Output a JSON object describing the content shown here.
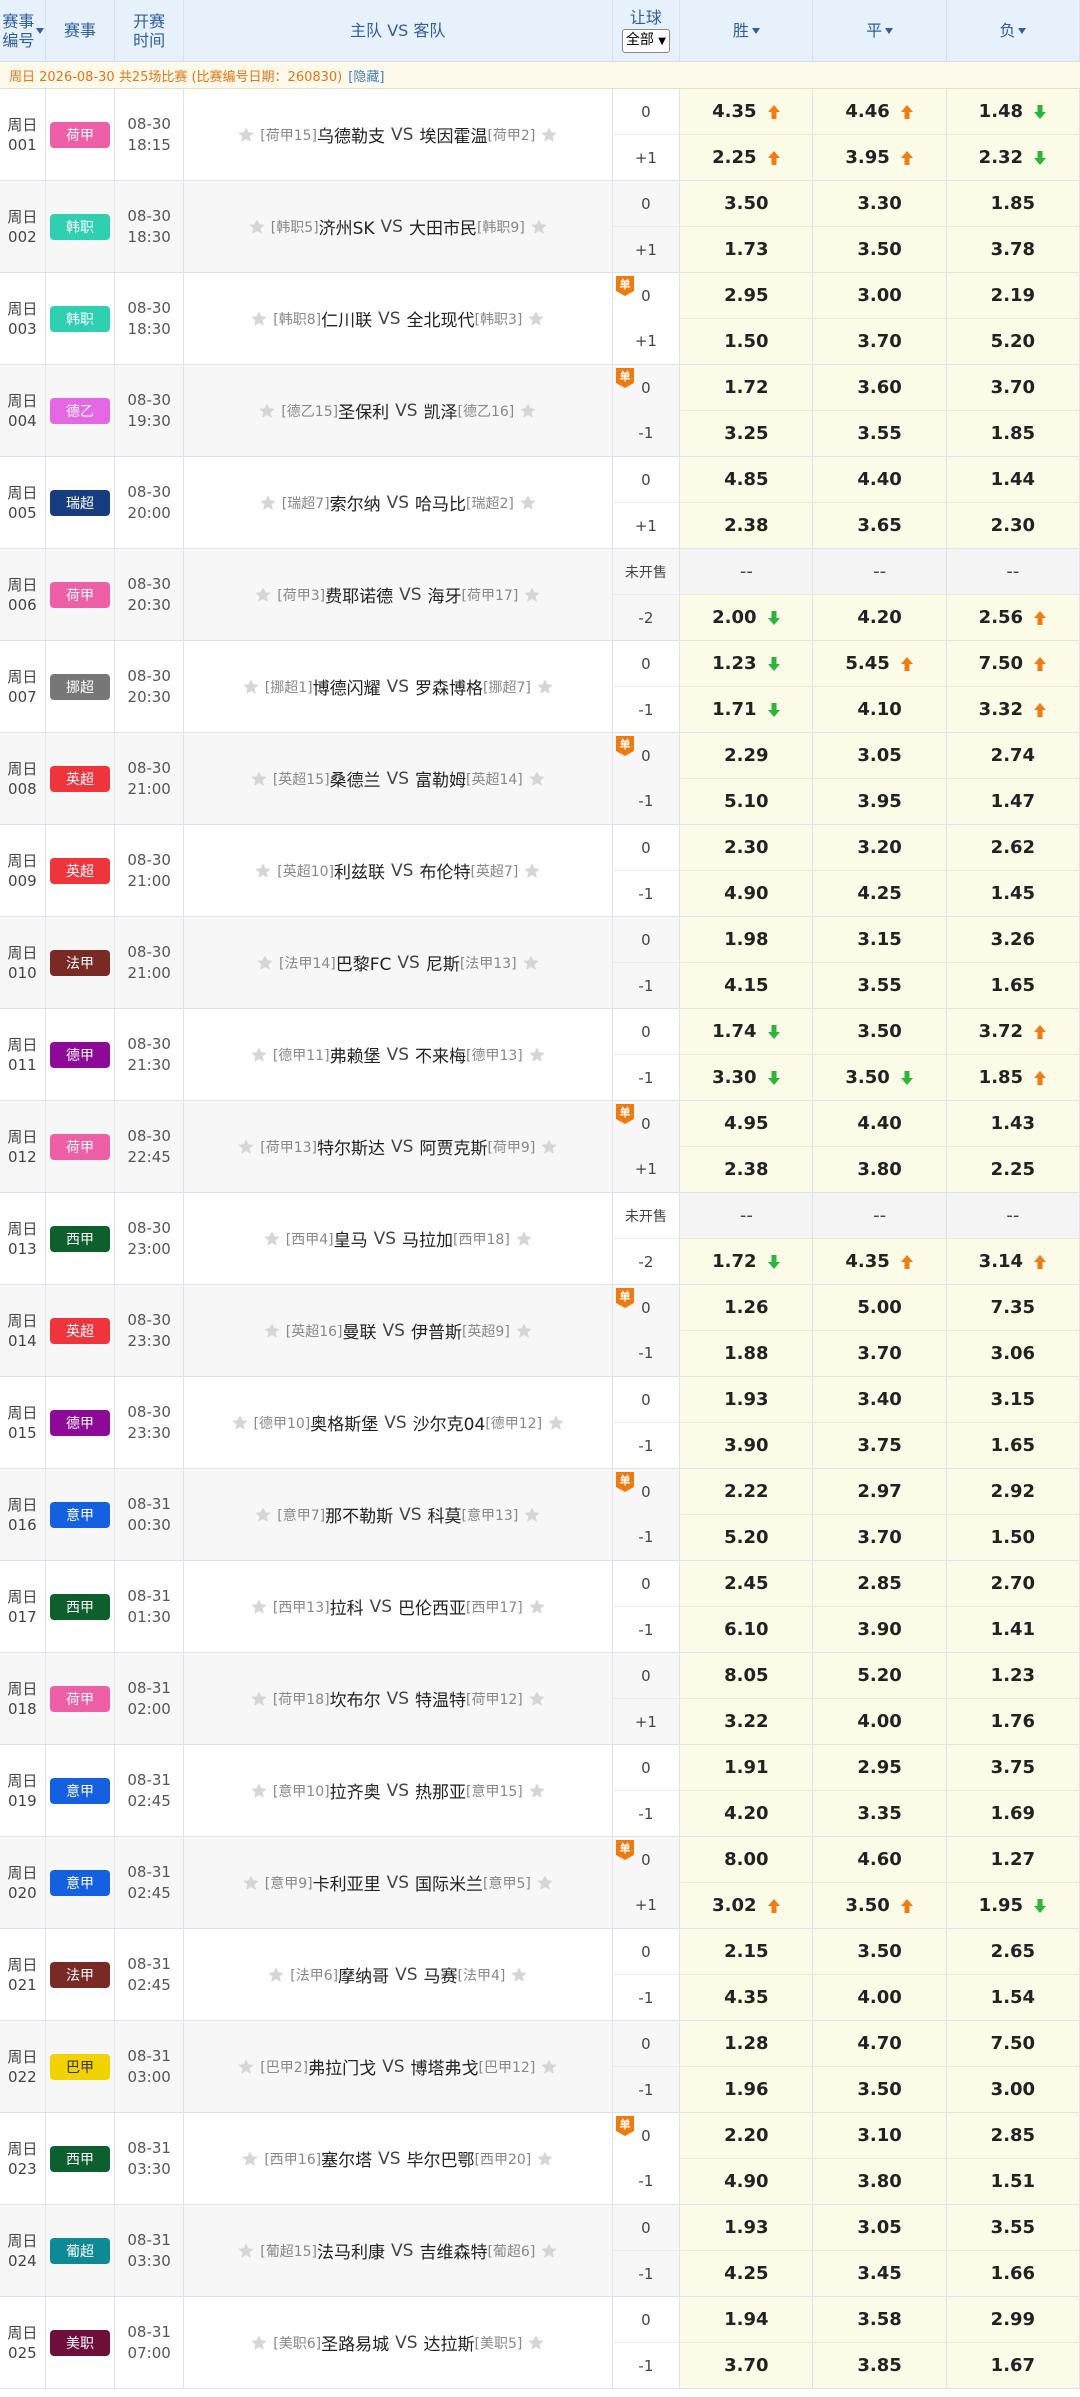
{
  "header": {
    "col1": "赛事编号",
    "col2": "赛事",
    "col3": "开赛时间",
    "col4": "主队 VS 客队",
    "col5": "让球",
    "select_value": "全部",
    "win": "胜",
    "draw": "平",
    "lose": "负"
  },
  "info": {
    "text": "周日 2026-08-30 共25场比赛 (比赛编号日期：260830)",
    "hide": "[隐藏]"
  },
  "not_sold": "未开售",
  "matches": [
    {
      "d": "周日",
      "n": "001",
      "lg": "荷甲",
      "lc": "#ee5fa7",
      "date": "08-30",
      "time": "18:15",
      "hr": "[荷甲15]",
      "h": "乌德勒支",
      "a": "埃因霍温",
      "ar": "[荷甲2]",
      "dan": false,
      "h1": "0",
      "h2": "+1",
      "o1": [
        "4.35",
        "4.46",
        "1.48"
      ],
      "a1": [
        "up",
        "up",
        "down"
      ],
      "o2": [
        "2.25",
        "3.95",
        "2.32"
      ],
      "a2": [
        "up",
        "up",
        "down"
      ]
    },
    {
      "d": "周日",
      "n": "002",
      "lg": "韩职",
      "lc": "#2fd0b1",
      "date": "08-30",
      "time": "18:30",
      "hr": "[韩职5]",
      "h": "济州SK",
      "a": "大田市民",
      "ar": "[韩职9]",
      "dan": false,
      "h1": "0",
      "h2": "+1",
      "o1": [
        "3.50",
        "3.30",
        "1.85"
      ],
      "a1": [
        "",
        "",
        ""
      ],
      "o2": [
        "1.73",
        "3.50",
        "3.78"
      ],
      "a2": [
        "",
        "",
        ""
      ]
    },
    {
      "d": "周日",
      "n": "003",
      "lg": "韩职",
      "lc": "#2fd0b1",
      "date": "08-30",
      "time": "18:30",
      "hr": "[韩职8]",
      "h": "仁川联",
      "a": "全北现代",
      "ar": "[韩职3]",
      "dan": true,
      "h1": "0",
      "h2": "+1",
      "o1": [
        "2.95",
        "3.00",
        "2.19"
      ],
      "a1": [
        "",
        "",
        ""
      ],
      "o2": [
        "1.50",
        "3.70",
        "5.20"
      ],
      "a2": [
        "",
        "",
        ""
      ]
    },
    {
      "d": "周日",
      "n": "004",
      "lg": "德乙",
      "lc": "#e667e3",
      "date": "08-30",
      "time": "19:30",
      "hr": "[德乙15]",
      "h": "圣保利",
      "a": "凯泽",
      "ar": "[德乙16]",
      "dan": true,
      "h1": "0",
      "h2": "-1",
      "o1": [
        "1.72",
        "3.60",
        "3.70"
      ],
      "a1": [
        "",
        "",
        ""
      ],
      "o2": [
        "3.25",
        "3.55",
        "1.85"
      ],
      "a2": [
        "",
        "",
        ""
      ]
    },
    {
      "d": "周日",
      "n": "005",
      "lg": "瑞超",
      "lc": "#173d80",
      "date": "08-30",
      "time": "20:00",
      "hr": "[瑞超7]",
      "h": "索尔纳",
      "a": "哈马比",
      "ar": "[瑞超2]",
      "dan": false,
      "h1": "0",
      "h2": "+1",
      "o1": [
        "4.85",
        "4.40",
        "1.44"
      ],
      "a1": [
        "",
        "",
        ""
      ],
      "o2": [
        "2.38",
        "3.65",
        "2.30"
      ],
      "a2": [
        "",
        "",
        ""
      ]
    },
    {
      "d": "周日",
      "n": "006",
      "lg": "荷甲",
      "lc": "#ee5fa7",
      "date": "08-30",
      "time": "20:30",
      "hr": "[荷甲3]",
      "h": "费耶诺德",
      "a": "海牙",
      "ar": "[荷甲17]",
      "dan": false,
      "h1": "",
      "h2": "-2",
      "ns": true,
      "o1": [
        "--",
        "--",
        "--"
      ],
      "a1": [
        "",
        "",
        ""
      ],
      "o2": [
        "2.00",
        "4.20",
        "2.56"
      ],
      "a2": [
        "down",
        "",
        "up"
      ]
    },
    {
      "d": "周日",
      "n": "007",
      "lg": "挪超",
      "lc": "#777777",
      "date": "08-30",
      "time": "20:30",
      "hr": "[挪超1]",
      "h": "博德闪耀",
      "a": "罗森博格",
      "ar": "[挪超7]",
      "dan": false,
      "h1": "0",
      "h2": "-1",
      "o1": [
        "1.23",
        "5.45",
        "7.50"
      ],
      "a1": [
        "down",
        "up",
        "up"
      ],
      "o2": [
        "1.71",
        "4.10",
        "3.32"
      ],
      "a2": [
        "down",
        "",
        "up"
      ]
    },
    {
      "d": "周日",
      "n": "008",
      "lg": "英超",
      "lc": "#f0343c",
      "date": "08-30",
      "time": "21:00",
      "hr": "[英超15]",
      "h": "桑德兰",
      "a": "富勒姆",
      "ar": "[英超14]",
      "dan": true,
      "h1": "0",
      "h2": "-1",
      "o1": [
        "2.29",
        "3.05",
        "2.74"
      ],
      "a1": [
        "",
        "",
        ""
      ],
      "o2": [
        "5.10",
        "3.95",
        "1.47"
      ],
      "a2": [
        "",
        "",
        ""
      ]
    },
    {
      "d": "周日",
      "n": "009",
      "lg": "英超",
      "lc": "#f0343c",
      "date": "08-30",
      "time": "21:00",
      "hr": "[英超10]",
      "h": "利兹联",
      "a": "布伦特",
      "ar": "[英超7]",
      "dan": false,
      "h1": "0",
      "h2": "-1",
      "o1": [
        "2.30",
        "3.20",
        "2.62"
      ],
      "a1": [
        "",
        "",
        ""
      ],
      "o2": [
        "4.90",
        "4.25",
        "1.45"
      ],
      "a2": [
        "",
        "",
        ""
      ]
    },
    {
      "d": "周日",
      "n": "010",
      "lg": "法甲",
      "lc": "#7a2a24",
      "date": "08-30",
      "time": "21:00",
      "hr": "[法甲14]",
      "h": "巴黎FC",
      "a": "尼斯",
      "ar": "[法甲13]",
      "dan": false,
      "h1": "0",
      "h2": "-1",
      "o1": [
        "1.98",
        "3.15",
        "3.26"
      ],
      "a1": [
        "",
        "",
        ""
      ],
      "o2": [
        "4.15",
        "3.55",
        "1.65"
      ],
      "a2": [
        "",
        "",
        ""
      ]
    },
    {
      "d": "周日",
      "n": "011",
      "lg": "德甲",
      "lc": "#8d0a98",
      "date": "08-30",
      "time": "21:30",
      "hr": "[德甲11]",
      "h": "弗赖堡",
      "a": "不来梅",
      "ar": "[德甲13]",
      "dan": false,
      "h1": "0",
      "h2": "-1",
      "o1": [
        "1.74",
        "3.50",
        "3.72"
      ],
      "a1": [
        "down",
        "",
        "up"
      ],
      "o2": [
        "3.30",
        "3.50",
        "1.85"
      ],
      "a2": [
        "down",
        "down",
        "up"
      ]
    },
    {
      "d": "周日",
      "n": "012",
      "lg": "荷甲",
      "lc": "#ee5fa7",
      "date": "08-30",
      "time": "22:45",
      "hr": "[荷甲13]",
      "h": "特尔斯达",
      "a": "阿贾克斯",
      "ar": "[荷甲9]",
      "dan": true,
      "h1": "0",
      "h2": "+1",
      "o1": [
        "4.95",
        "4.40",
        "1.43"
      ],
      "a1": [
        "",
        "",
        ""
      ],
      "o2": [
        "2.38",
        "3.80",
        "2.25"
      ],
      "a2": [
        "",
        "",
        ""
      ]
    },
    {
      "d": "周日",
      "n": "013",
      "lg": "西甲",
      "lc": "#0e5f2e",
      "date": "08-30",
      "time": "23:00",
      "hr": "[西甲4]",
      "h": "皇马",
      "a": "马拉加",
      "ar": "[西甲18]",
      "dan": false,
      "h1": "",
      "h2": "-2",
      "ns": true,
      "o1": [
        "--",
        "--",
        "--"
      ],
      "a1": [
        "",
        "",
        ""
      ],
      "o2": [
        "1.72",
        "4.35",
        "3.14"
      ],
      "a2": [
        "down",
        "up",
        "up"
      ]
    },
    {
      "d": "周日",
      "n": "014",
      "lg": "英超",
      "lc": "#f0343c",
      "date": "08-30",
      "time": "23:30",
      "hr": "[英超16]",
      "h": "曼联",
      "a": "伊普斯",
      "ar": "[英超9]",
      "dan": true,
      "h1": "0",
      "h2": "-1",
      "o1": [
        "1.26",
        "5.00",
        "7.35"
      ],
      "a1": [
        "",
        "",
        ""
      ],
      "o2": [
        "1.88",
        "3.70",
        "3.06"
      ],
      "a2": [
        "",
        "",
        ""
      ]
    },
    {
      "d": "周日",
      "n": "015",
      "lg": "德甲",
      "lc": "#8d0a98",
      "date": "08-30",
      "time": "23:30",
      "hr": "[德甲10]",
      "h": "奥格斯堡",
      "a": "沙尔克04",
      "ar": "[德甲12]",
      "dan": false,
      "h1": "0",
      "h2": "-1",
      "o1": [
        "1.93",
        "3.40",
        "3.15"
      ],
      "a1": [
        "",
        "",
        ""
      ],
      "o2": [
        "3.90",
        "3.75",
        "1.65"
      ],
      "a2": [
        "",
        "",
        ""
      ]
    },
    {
      "d": "周日",
      "n": "016",
      "lg": "意甲",
      "lc": "#1460e0",
      "date": "08-31",
      "time": "00:30",
      "hr": "[意甲7]",
      "h": "那不勒斯",
      "a": "科莫",
      "ar": "[意甲13]",
      "dan": true,
      "h1": "0",
      "h2": "-1",
      "o1": [
        "2.22",
        "2.97",
        "2.92"
      ],
      "a1": [
        "",
        "",
        ""
      ],
      "o2": [
        "5.20",
        "3.70",
        "1.50"
      ],
      "a2": [
        "",
        "",
        ""
      ]
    },
    {
      "d": "周日",
      "n": "017",
      "lg": "西甲",
      "lc": "#0e5f2e",
      "date": "08-31",
      "time": "01:30",
      "hr": "[西甲13]",
      "h": "拉科",
      "a": "巴伦西亚",
      "ar": "[西甲17]",
      "dan": false,
      "h1": "0",
      "h2": "-1",
      "o1": [
        "2.45",
        "2.85",
        "2.70"
      ],
      "a1": [
        "",
        "",
        ""
      ],
      "o2": [
        "6.10",
        "3.90",
        "1.41"
      ],
      "a2": [
        "",
        "",
        ""
      ]
    },
    {
      "d": "周日",
      "n": "018",
      "lg": "荷甲",
      "lc": "#ee5fa7",
      "date": "08-31",
      "time": "02:00",
      "hr": "[荷甲18]",
      "h": "坎布尔",
      "a": "特温特",
      "ar": "[荷甲12]",
      "dan": false,
      "h1": "0",
      "h2": "+1",
      "o1": [
        "8.05",
        "5.20",
        "1.23"
      ],
      "a1": [
        "",
        "",
        ""
      ],
      "o2": [
        "3.22",
        "4.00",
        "1.76"
      ],
      "a2": [
        "",
        "",
        ""
      ]
    },
    {
      "d": "周日",
      "n": "019",
      "lg": "意甲",
      "lc": "#1460e0",
      "date": "08-31",
      "time": "02:45",
      "hr": "[意甲10]",
      "h": "拉齐奥",
      "a": "热那亚",
      "ar": "[意甲15]",
      "dan": false,
      "h1": "0",
      "h2": "-1",
      "o1": [
        "1.91",
        "2.95",
        "3.75"
      ],
      "a1": [
        "",
        "",
        ""
      ],
      "o2": [
        "4.20",
        "3.35",
        "1.69"
      ],
      "a2": [
        "",
        "",
        ""
      ]
    },
    {
      "d": "周日",
      "n": "020",
      "lg": "意甲",
      "lc": "#1460e0",
      "date": "08-31",
      "time": "02:45",
      "hr": "[意甲9]",
      "h": "卡利亚里",
      "a": "国际米兰",
      "ar": "[意甲5]",
      "dan": true,
      "h1": "0",
      "h2": "+1",
      "o1": [
        "8.00",
        "4.60",
        "1.27"
      ],
      "a1": [
        "",
        "",
        ""
      ],
      "o2": [
        "3.02",
        "3.50",
        "1.95"
      ],
      "a2": [
        "up",
        "up",
        "down"
      ]
    },
    {
      "d": "周日",
      "n": "021",
      "lg": "法甲",
      "lc": "#7a2a24",
      "date": "08-31",
      "time": "02:45",
      "hr": "[法甲6]",
      "h": "摩纳哥",
      "a": "马赛",
      "ar": "[法甲4]",
      "dan": false,
      "h1": "0",
      "h2": "-1",
      "o1": [
        "2.15",
        "3.50",
        "2.65"
      ],
      "a1": [
        "",
        "",
        ""
      ],
      "o2": [
        "4.35",
        "4.00",
        "1.54"
      ],
      "a2": [
        "",
        "",
        ""
      ]
    },
    {
      "d": "周日",
      "n": "022",
      "lg": "巴甲",
      "lc": "#f2d300",
      "date": "08-31",
      "time": "03:00",
      "hr": "[巴甲2]",
      "h": "弗拉门戈",
      "a": "博塔弗戈",
      "ar": "[巴甲12]",
      "dan": false,
      "h1": "0",
      "h2": "-1",
      "o1": [
        "1.28",
        "4.70",
        "7.50"
      ],
      "a1": [
        "",
        "",
        ""
      ],
      "o2": [
        "1.96",
        "3.50",
        "3.00"
      ],
      "a2": [
        "",
        "",
        ""
      ]
    },
    {
      "d": "周日",
      "n": "023",
      "lg": "西甲",
      "lc": "#0e5f2e",
      "date": "08-31",
      "time": "03:30",
      "hr": "[西甲16]",
      "h": "塞尔塔",
      "a": "毕尔巴鄂",
      "ar": "[西甲20]",
      "dan": true,
      "h1": "0",
      "h2": "-1",
      "o1": [
        "2.20",
        "3.10",
        "2.85"
      ],
      "a1": [
        "",
        "",
        ""
      ],
      "o2": [
        "4.90",
        "3.80",
        "1.51"
      ],
      "a2": [
        "",
        "",
        ""
      ]
    },
    {
      "d": "周日",
      "n": "024",
      "lg": "葡超",
      "lc": "#0e8a96",
      "date": "08-31",
      "time": "03:30",
      "hr": "[葡超15]",
      "h": "法马利康",
      "a": "吉维森特",
      "ar": "[葡超6]",
      "dan": false,
      "h1": "0",
      "h2": "-1",
      "o1": [
        "1.93",
        "3.05",
        "3.55"
      ],
      "a1": [
        "",
        "",
        ""
      ],
      "o2": [
        "4.25",
        "3.45",
        "1.66"
      ],
      "a2": [
        "",
        "",
        ""
      ]
    },
    {
      "d": "周日",
      "n": "025",
      "lg": "美职",
      "lc": "#6e0f3a",
      "date": "08-31",
      "time": "07:00",
      "hr": "[美职6]",
      "h": "圣路易城",
      "a": "达拉斯",
      "ar": "[美职5]",
      "dan": false,
      "h1": "0",
      "h2": "-1",
      "o1": [
        "1.94",
        "3.58",
        "2.99"
      ],
      "a1": [
        "",
        "",
        ""
      ],
      "o2": [
        "3.70",
        "3.85",
        "1.67"
      ],
      "a2": [
        "",
        "",
        ""
      ]
    }
  ]
}
